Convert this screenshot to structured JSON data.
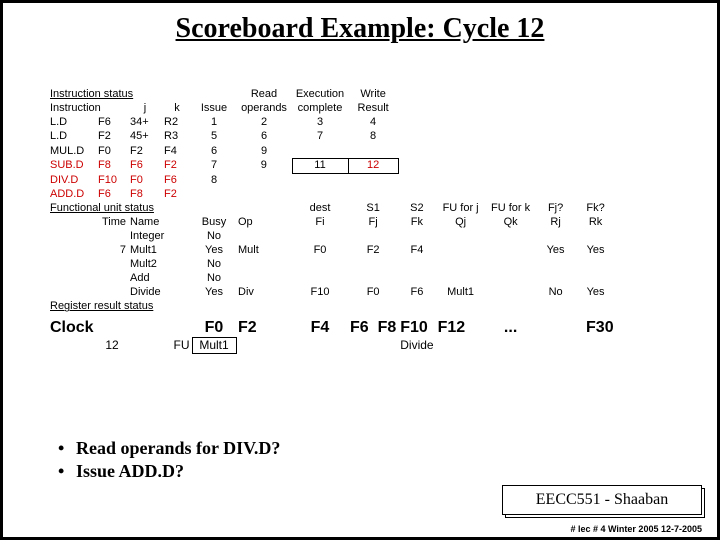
{
  "title": "Scoreboard Example:  Cycle 12",
  "headers": {
    "instr_status": "Instruction status",
    "instr": "Instruction",
    "j": "j",
    "k": "k",
    "issue": "Issue",
    "read": "Read",
    "operands": "operands",
    "execution": "Execution",
    "complete": "complete",
    "write": "Write",
    "result": "Result",
    "func_unit": "Functional unit status",
    "time": "Time",
    "name": "Name",
    "busy": "Busy",
    "op": "Op",
    "dest": "dest",
    "fi": "Fi",
    "s1": "S1",
    "fj": "Fj",
    "s2": "S2",
    "fk": "Fk",
    "fuj": "FU for j",
    "qj": "Qj",
    "fuk": "FU for k",
    "qk": "Qk",
    "fjq": "Fj?",
    "rj": "Rj",
    "fkq": "Fk?",
    "rk": "Rk",
    "reg_result": "Register result status",
    "clock": "Clock",
    "fu": "FU"
  },
  "instructions": [
    {
      "op": "L.D",
      "d": "F6",
      "j": "34+",
      "k": "R2",
      "issue": "1",
      "read": "2",
      "exec": "3",
      "write": "4"
    },
    {
      "op": "L.D",
      "d": "F2",
      "j": "45+",
      "k": "R3",
      "issue": "5",
      "read": "6",
      "exec": "7",
      "write": "8"
    },
    {
      "op": "MUL.D",
      "d": "F0",
      "j": "F2",
      "k": "F4",
      "issue": "6",
      "read": "9",
      "exec": "",
      "write": ""
    },
    {
      "op": "SUB.D",
      "d": "F8",
      "j": "F6",
      "k": "F2",
      "issue": "7",
      "read": "9",
      "exec": "11",
      "write": "12"
    },
    {
      "op": "DIV.D",
      "d": "F10",
      "j": "F0",
      "k": "F6",
      "issue": "8",
      "read": "",
      "exec": "",
      "write": ""
    },
    {
      "op": "ADD.D",
      "d": "F6",
      "j": "F8",
      "k": "F2",
      "issue": "",
      "read": "",
      "exec": "",
      "write": ""
    }
  ],
  "fu_rows": [
    {
      "time": "",
      "name": "Integer",
      "busy": "No",
      "op": "",
      "fi": "",
      "fj": "",
      "fk": "",
      "qj": "",
      "qk": "",
      "rj": "",
      "rk": ""
    },
    {
      "time": "7",
      "name": "Mult1",
      "busy": "Yes",
      "op": "Mult",
      "fi": "F0",
      "fj": "F2",
      "fk": "F4",
      "qj": "",
      "qk": "",
      "rj": "Yes",
      "rk": "Yes"
    },
    {
      "time": "",
      "name": "Mult2",
      "busy": "No",
      "op": "",
      "fi": "",
      "fj": "",
      "fk": "",
      "qj": "",
      "qk": "",
      "rj": "",
      "rk": ""
    },
    {
      "time": "",
      "name": "Add",
      "busy": "No",
      "op": "",
      "fi": "",
      "fj": "",
      "fk": "",
      "qj": "",
      "qk": "",
      "rj": "",
      "rk": ""
    },
    {
      "time": "",
      "name": "Divide",
      "busy": "Yes",
      "op": "Div",
      "fi": "F10",
      "fj": "F0",
      "fk": "F6",
      "qj": "Mult1",
      "qk": "",
      "rj": "No",
      "rk": "Yes"
    }
  ],
  "clock": {
    "label": "Clock",
    "value": "12",
    "fu": "FU"
  },
  "regs": {
    "labels": [
      "F0",
      "F2",
      "F4",
      "F6",
      "F8",
      "F10",
      "F12",
      "...",
      "F30"
    ],
    "values": [
      "Mult1",
      "",
      "",
      "",
      "",
      "Divide",
      "",
      "",
      ""
    ]
  },
  "bullets": [
    "Read operands for DIV.D?",
    "Issue ADD.D?"
  ],
  "course": "EECC551 - Shaaban",
  "footer": "#  lec # 4  Winter 2005   12-7-2005"
}
